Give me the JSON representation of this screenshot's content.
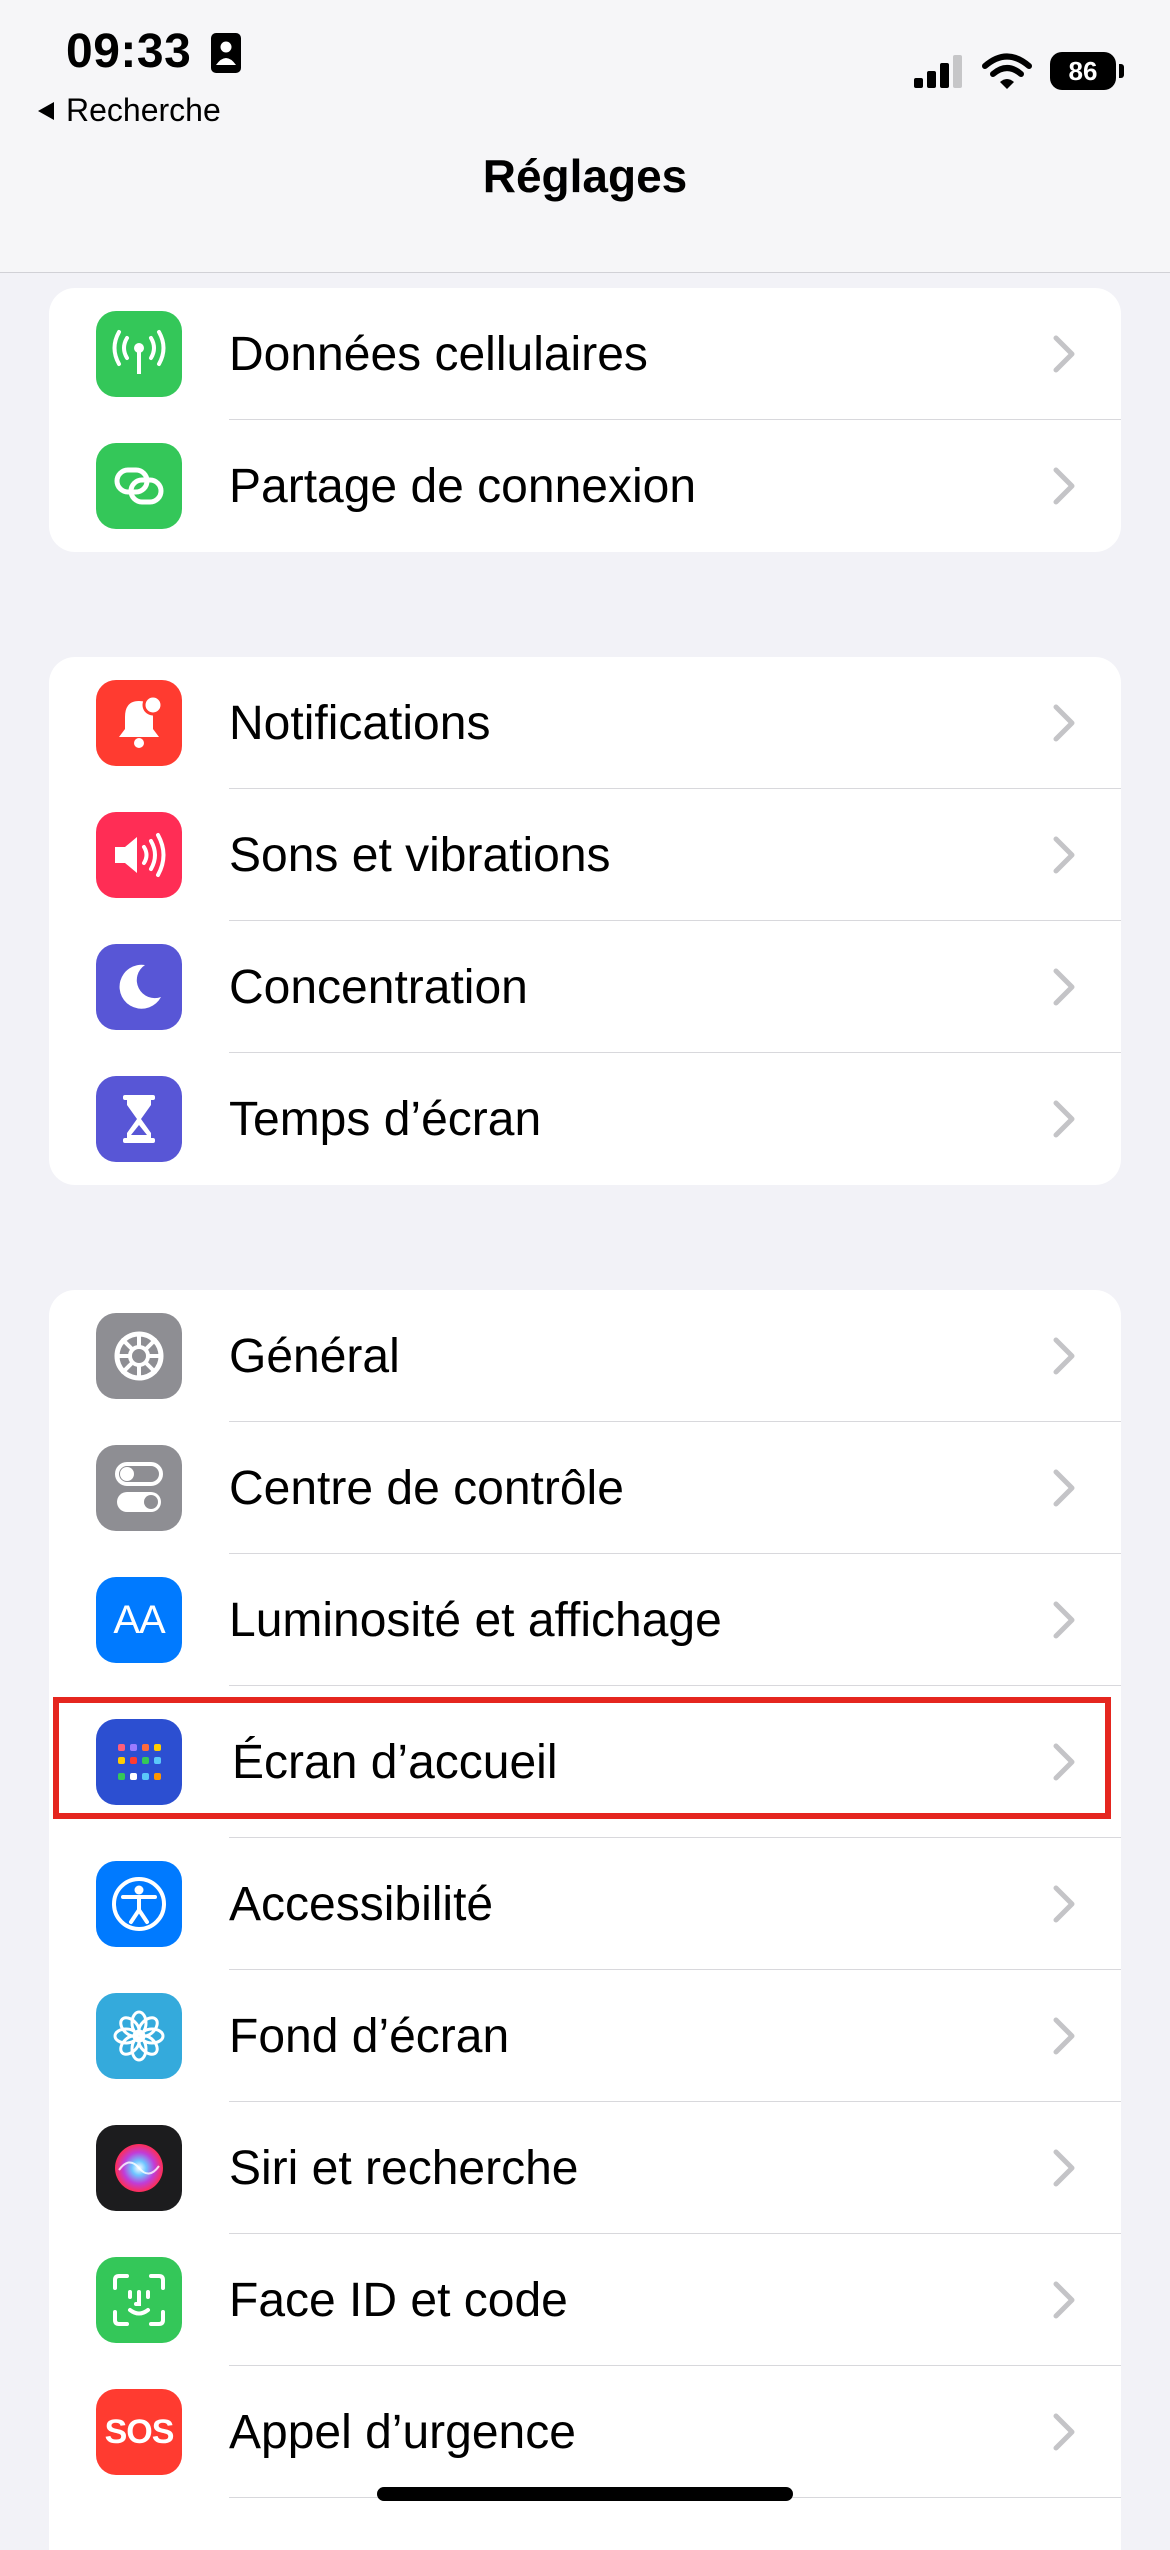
{
  "status_bar": {
    "time": "09:33",
    "back_label": "Recherche",
    "battery": "86"
  },
  "nav": {
    "title": "Réglages"
  },
  "groups": [
    {
      "items": [
        {
          "label": "Données cellulaires",
          "icon": "cellular-antenna-icon",
          "color": "#34c759"
        },
        {
          "label": "Partage de connexion",
          "icon": "hotspot-chain-icon",
          "color": "#34c759"
        }
      ]
    },
    {
      "items": [
        {
          "label": "Notifications",
          "icon": "bell-badge-icon",
          "color": "#ff3b30"
        },
        {
          "label": "Sons et vibrations",
          "icon": "speaker-icon",
          "color": "#ff2d55"
        },
        {
          "label": "Concentration",
          "icon": "moon-icon",
          "color": "#5856d6"
        },
        {
          "label": "Temps d’écran",
          "icon": "hourglass-icon",
          "color": "#5856d6"
        }
      ]
    },
    {
      "items": [
        {
          "label": "Général",
          "icon": "gear-icon",
          "color": "#8e8e93"
        },
        {
          "label": "Centre de contrôle",
          "icon": "toggles-icon",
          "color": "#8e8e93"
        },
        {
          "label": "Luminosité et affichage",
          "icon": "text-size-icon",
          "color": "#007aff"
        },
        {
          "label": "Écran d’accueil",
          "icon": "home-screen-grid-icon",
          "color": "#2c4fd1"
        },
        {
          "label": "Accessibilité",
          "icon": "accessibility-icon",
          "color": "#007aff"
        },
        {
          "label": "Fond d’écran",
          "icon": "flower-icon",
          "color": "#34aadc"
        },
        {
          "label": "Siri et recherche",
          "icon": "siri-orb-icon",
          "color": "#1c1c1e"
        },
        {
          "label": "Face ID et code",
          "icon": "face-id-icon",
          "color": "#34c759"
        },
        {
          "label": "Appel d’urgence",
          "icon": "sos-icon",
          "color": "#ff3b30",
          "icon_text": "SOS"
        }
      ]
    }
  ],
  "aa_glyph": "AA",
  "highlight_color": "#e5261f"
}
